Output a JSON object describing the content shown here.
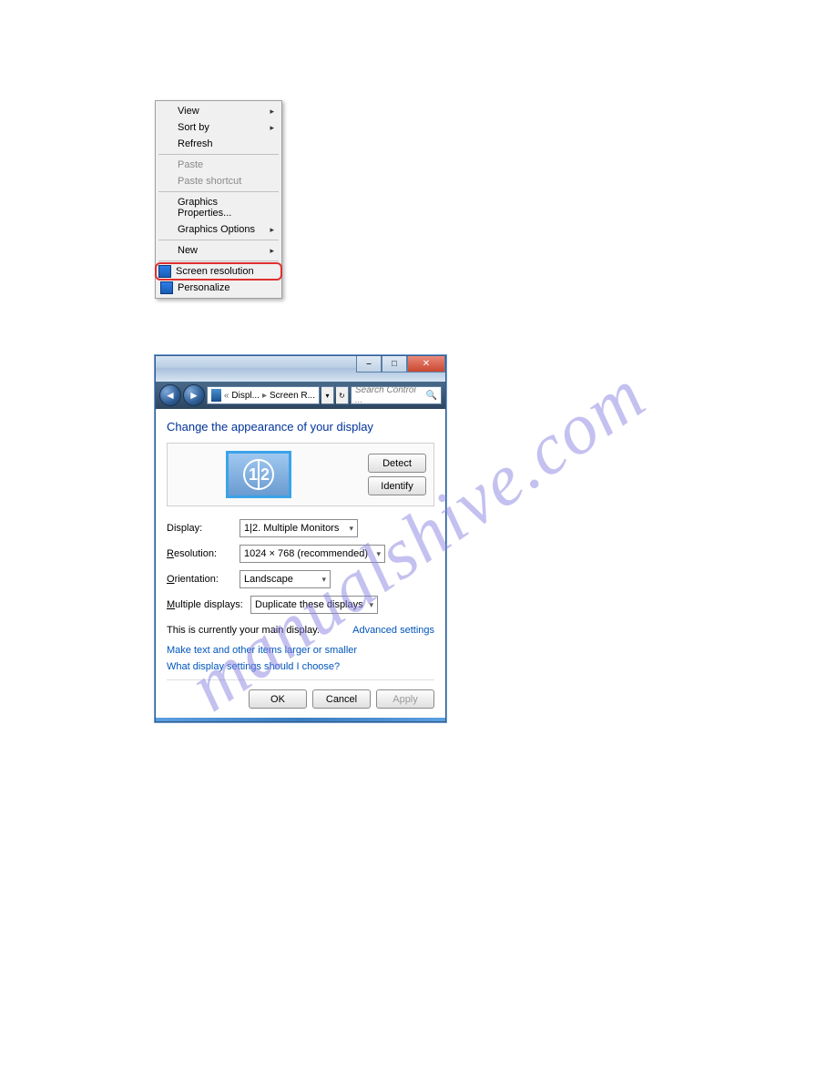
{
  "watermark": "manualshive.com",
  "context_menu": {
    "items": [
      {
        "label": "View",
        "arrow": true,
        "enabled": true
      },
      {
        "label": "Sort by",
        "arrow": true,
        "enabled": true
      },
      {
        "label": "Refresh",
        "arrow": false,
        "enabled": true
      }
    ],
    "items2": [
      {
        "label": "Paste",
        "enabled": false
      },
      {
        "label": "Paste shortcut",
        "enabled": false
      }
    ],
    "items3": [
      {
        "label": "Graphics Properties...",
        "enabled": true
      },
      {
        "label": "Graphics Options",
        "arrow": true,
        "enabled": true
      }
    ],
    "items4": [
      {
        "label": "New",
        "arrow": true,
        "enabled": true
      }
    ],
    "items5": [
      {
        "label": "Screen resolution",
        "highlight": true,
        "icon": "screen"
      },
      {
        "label": "Personalize",
        "icon": "personalize"
      }
    ]
  },
  "window": {
    "breadcrumb": {
      "prefix": "«",
      "part1": "Displ...",
      "sep": "▸",
      "part2": "Screen R..."
    },
    "search_placeholder": "Search Control ...",
    "heading": "Change the appearance of your display",
    "monitor_nums": "1 2",
    "detect": "Detect",
    "identify": "Identify",
    "labels": {
      "display": "Display:",
      "resolution": "Resolution:",
      "orientation": "Orientation:",
      "multiple": "Multiple displays:"
    },
    "values": {
      "display": "1|2. Multiple Monitors",
      "resolution": "1024 × 768 (recommended)",
      "orientation": "Landscape",
      "multiple": "Duplicate these displays"
    },
    "main_display_text": "This is currently your main display.",
    "advanced": "Advanced settings",
    "link1": "Make text and other items larger or smaller",
    "link2": "What display settings should I choose?",
    "btn_ok": "OK",
    "btn_cancel": "Cancel",
    "btn_apply": "Apply"
  }
}
